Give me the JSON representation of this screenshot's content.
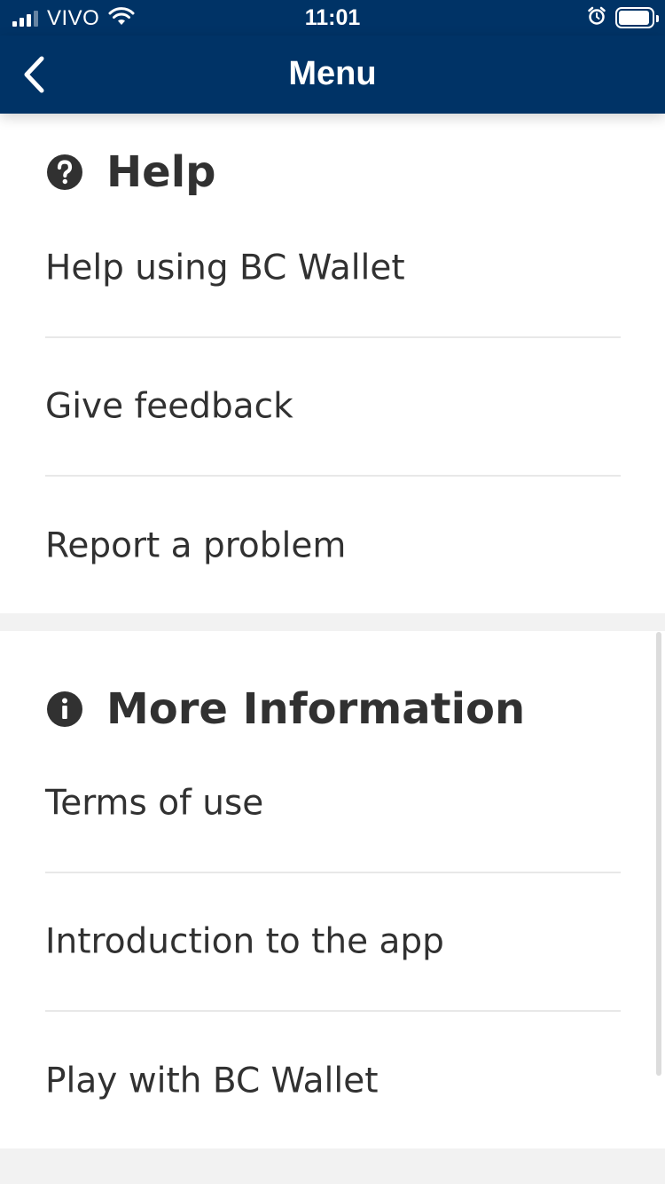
{
  "status_bar": {
    "carrier": "VIVO",
    "time": "11:01",
    "signal_bars": 3,
    "icons": [
      "signal-icon",
      "wifi-icon",
      "alarm-icon",
      "battery-icon"
    ]
  },
  "nav": {
    "title": "Menu",
    "back_icon": "chevron-left-icon"
  },
  "sections": {
    "help": {
      "title": "Help",
      "icon": "question-circle-icon",
      "items": [
        {
          "label": "Help using BC Wallet"
        },
        {
          "label": "Give feedback"
        },
        {
          "label": "Report a problem"
        }
      ]
    },
    "more_info": {
      "title": "More Information",
      "icon": "info-circle-icon",
      "items": [
        {
          "label": "Terms of use"
        },
        {
          "label": "Introduction to the app"
        },
        {
          "label": "Play with BC Wallet"
        }
      ]
    }
  },
  "colors": {
    "header_bg": "#003366",
    "page_bg": "#f2f2f2",
    "card_bg": "#ffffff",
    "text": "#313131",
    "divider": "#e8e8e8"
  }
}
